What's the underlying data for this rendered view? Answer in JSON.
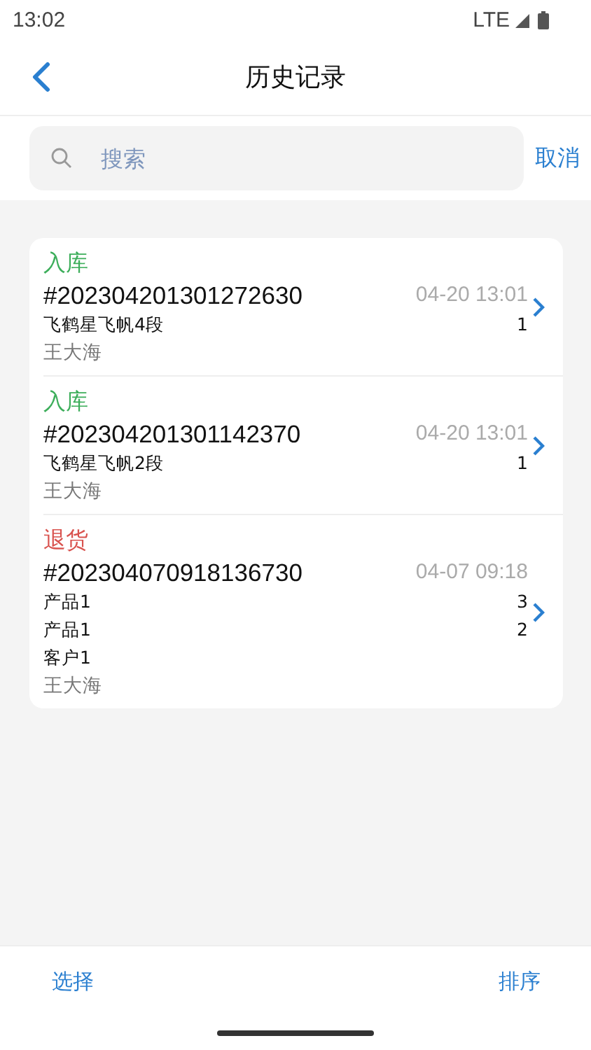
{
  "status_bar": {
    "time": "13:02",
    "network": "LTE"
  },
  "header": {
    "title": "历史记录"
  },
  "search": {
    "placeholder": "搜索",
    "cancel": "取消"
  },
  "records": [
    {
      "type": "入库",
      "color": "#3dae5b",
      "number": "#202304201301272630",
      "time": "04-20 13:01",
      "items": [
        {
          "name": "飞鹤星飞帆4段",
          "qty": "1"
        }
      ],
      "operator": "王大海"
    },
    {
      "type": "入库",
      "color": "#3dae5b",
      "number": "#202304201301142370",
      "time": "04-20 13:01",
      "items": [
        {
          "name": "飞鹤星飞帆2段",
          "qty": "1"
        }
      ],
      "operator": "王大海"
    },
    {
      "type": "退货",
      "color": "#d9534f",
      "number": "#202304070918136730",
      "time": "04-07 09:18",
      "items": [
        {
          "name": "产品1",
          "qty": "3"
        },
        {
          "name": "产品1",
          "qty": "2"
        }
      ],
      "customer": "客户1",
      "operator": "王大海"
    }
  ],
  "bottom_bar": {
    "left": "选择",
    "right": "排序"
  }
}
